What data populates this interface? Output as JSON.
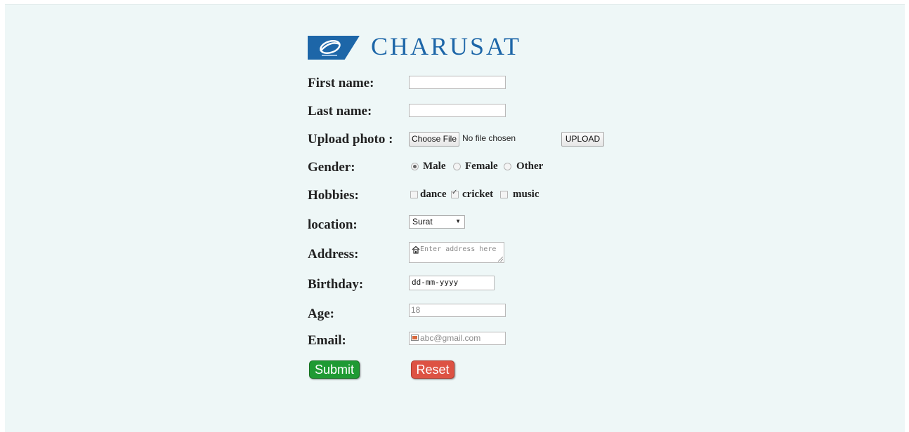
{
  "brand": {
    "name": "CHARUSAT",
    "logo_color": "#1d66a8"
  },
  "form": {
    "first_name": {
      "label": "First name:",
      "value": ""
    },
    "last_name": {
      "label": "Last name:",
      "value": ""
    },
    "photo": {
      "label": "Upload photo :",
      "choose_label": "Choose File",
      "status": "No file chosen",
      "upload_label": "UPLOAD"
    },
    "gender": {
      "label": "Gender:",
      "options": [
        "Male",
        "Female",
        "Other"
      ],
      "selected": "Male"
    },
    "hobbies": {
      "label": "Hobbies:",
      "options": [
        "dance",
        "cricket",
        "music"
      ],
      "checked": [
        "cricket"
      ]
    },
    "location": {
      "label": "location:",
      "selected": "Surat"
    },
    "address": {
      "label": "Address:",
      "placeholder": "Enter address here",
      "icon": "home-icon"
    },
    "birthday": {
      "label": "Birthday:",
      "value": "dd-mm-yyyy"
    },
    "age": {
      "label": "Age:",
      "value": "18"
    },
    "email": {
      "label": "Email:",
      "placeholder": "abc@gmail.com",
      "icon": "email-icon"
    },
    "submit_label": "Submit",
    "reset_label": "Reset",
    "submit_color": "#1f9a33",
    "reset_color": "#dd5243"
  }
}
